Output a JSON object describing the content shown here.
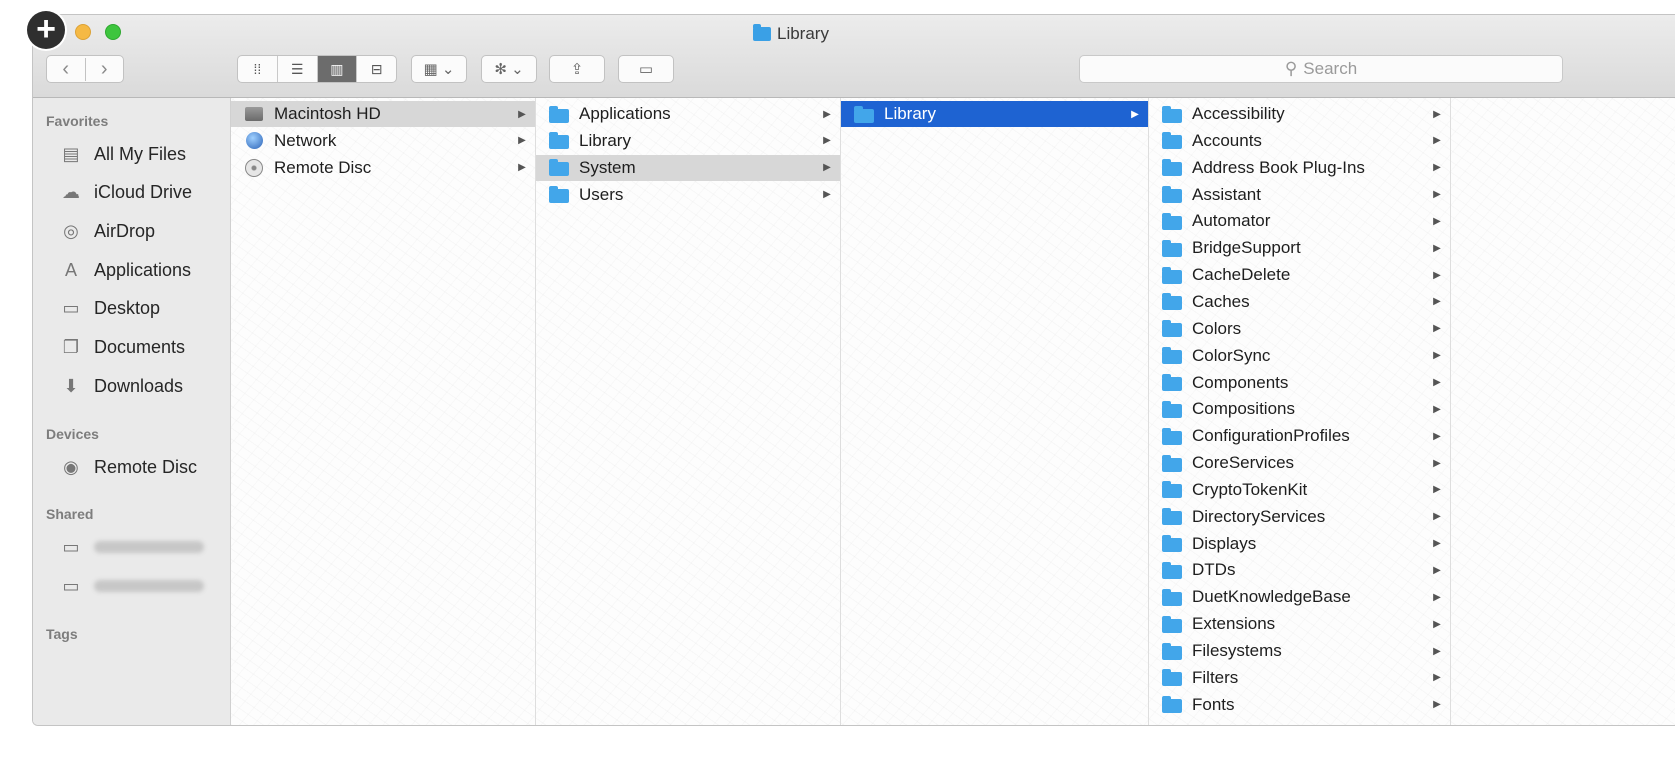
{
  "window": {
    "title": "Library"
  },
  "toolbar": {
    "back_glyph": "‹",
    "forward_glyph": "›",
    "view_icons": [
      "⁞⁞",
      "☰",
      "▥",
      "⊟"
    ],
    "arrange_glyph": "▦ ⌄",
    "action_glyph": "✻ ⌄",
    "share_glyph": "⇪",
    "tag_glyph": "▭",
    "search_icon": "⚲",
    "search_placeholder": "Search"
  },
  "sidebar": {
    "favorites_header": "Favorites",
    "favorites": [
      {
        "label": "All My Files",
        "icon": "all-files-icon",
        "glyph": "▤"
      },
      {
        "label": "iCloud Drive",
        "icon": "cloud-icon",
        "glyph": "☁"
      },
      {
        "label": "AirDrop",
        "icon": "airdrop-icon",
        "glyph": "◎"
      },
      {
        "label": "Applications",
        "icon": "applications-icon",
        "glyph": "A"
      },
      {
        "label": "Desktop",
        "icon": "desktop-icon",
        "glyph": "▭"
      },
      {
        "label": "Documents",
        "icon": "documents-icon",
        "glyph": "❐"
      },
      {
        "label": "Downloads",
        "icon": "downloads-icon",
        "glyph": "⬇"
      }
    ],
    "devices_header": "Devices",
    "devices": [
      {
        "label": "Remote Disc",
        "icon": "remote-disc-icon",
        "glyph": "◉"
      }
    ],
    "shared_header": "Shared",
    "shared": [
      {
        "icon": "server-icon",
        "glyph": "▭"
      },
      {
        "icon": "computer-icon",
        "glyph": "▭"
      }
    ],
    "tags_header": "Tags"
  },
  "columns": [
    [
      {
        "label": "Macintosh HD",
        "icon": "hard-drive-icon",
        "selected": "gray"
      },
      {
        "label": "Network",
        "icon": "globe-icon",
        "selected": ""
      },
      {
        "label": "Remote Disc",
        "icon": "disc-icon",
        "selected": ""
      }
    ],
    [
      {
        "label": "Applications",
        "icon": "folder-icon",
        "selected": ""
      },
      {
        "label": "Library",
        "icon": "folder-icon",
        "selected": ""
      },
      {
        "label": "System",
        "icon": "folder-icon",
        "selected": "gray"
      },
      {
        "label": "Users",
        "icon": "folder-icon",
        "selected": ""
      }
    ],
    [
      {
        "label": "Library",
        "icon": "folder-icon",
        "selected": "blue"
      }
    ],
    [
      {
        "label": "Accessibility"
      },
      {
        "label": "Accounts"
      },
      {
        "label": "Address Book Plug-Ins"
      },
      {
        "label": "Assistant"
      },
      {
        "label": "Automator"
      },
      {
        "label": "BridgeSupport"
      },
      {
        "label": "CacheDelete"
      },
      {
        "label": "Caches"
      },
      {
        "label": "Colors"
      },
      {
        "label": "ColorSync"
      },
      {
        "label": "Components"
      },
      {
        "label": "Compositions"
      },
      {
        "label": "ConfigurationProfiles"
      },
      {
        "label": "CoreServices"
      },
      {
        "label": "CryptoTokenKit"
      },
      {
        "label": "DirectoryServices"
      },
      {
        "label": "Displays"
      },
      {
        "label": "DTDs"
      },
      {
        "label": "DuetKnowledgeBase"
      },
      {
        "label": "Extensions"
      },
      {
        "label": "Filesystems"
      },
      {
        "label": "Filters"
      },
      {
        "label": "Fonts"
      }
    ]
  ],
  "colors": {
    "selection_blue": "#1e63d2",
    "folder_blue": "#42a6ea"
  }
}
